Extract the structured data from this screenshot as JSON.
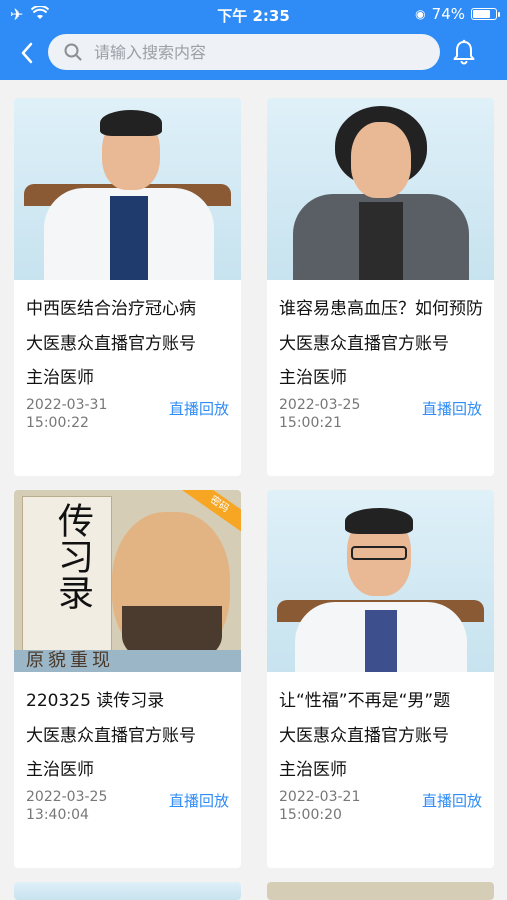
{
  "status_bar": {
    "time": "下午 2:35",
    "battery": "74%",
    "battery_level": 0.74
  },
  "search": {
    "placeholder": "请输入搜索内容"
  },
  "colors": {
    "accent": "#2f8cf6",
    "badge": "#f6a623"
  },
  "icons": [
    "airplane-icon",
    "wifi-icon",
    "back-icon",
    "search-icon",
    "bell-icon",
    "orientation-lock-icon",
    "battery-icon"
  ],
  "cards": [
    {
      "title": "中西医结合治疗冠心病",
      "account": "大医惠众直播官方账号",
      "role": "主治医师",
      "date": "2022-03-31",
      "time": "15:00:22",
      "action": "直播回放"
    },
    {
      "title": "谁容易患高血压？如何预防",
      "account": "大医惠众直播官方账号",
      "role": "主治医师",
      "date": "2022-03-25",
      "time": "15:00:21",
      "action": "直播回放"
    },
    {
      "title": "220325 读传习录",
      "account": "大医惠众直播官方账号",
      "role": "主治医师",
      "date": "2022-03-25",
      "time": "13:40:04",
      "action": "直播回放",
      "badge": "密码",
      "book_title": "传习录",
      "book_banner": "原貌重现"
    },
    {
      "title": "让“性福”不再是“男”题",
      "account": "大医惠众直播官方账号",
      "role": "主治医师",
      "date": "2022-03-21",
      "time": "15:00:20",
      "action": "直播回放"
    }
  ]
}
